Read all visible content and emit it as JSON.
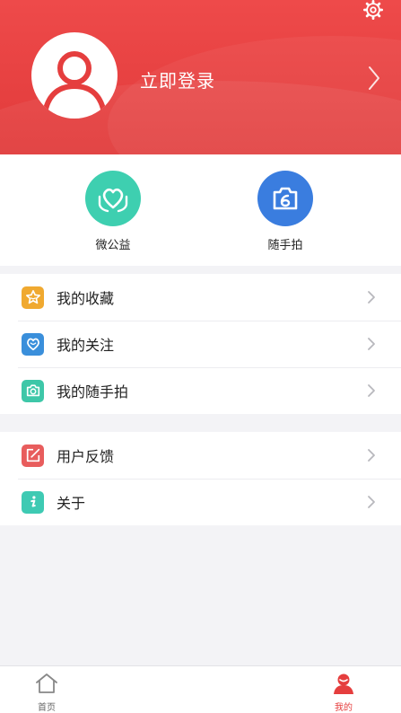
{
  "header": {
    "login_label": "立即登录",
    "bg_color": "#e53e3e"
  },
  "quick_actions": [
    {
      "label": "微公益",
      "icon": "heart-hands-icon",
      "color": "#3ecfb0"
    },
    {
      "label": "随手拍",
      "icon": "camera-icon",
      "color": "#3a7ddf"
    }
  ],
  "menu_group_1": [
    {
      "label": "我的收藏",
      "icon": "star-icon",
      "color": "#f0a930"
    },
    {
      "label": "我的关注",
      "icon": "heart-icon",
      "color": "#3a8fdb"
    },
    {
      "label": "我的随手拍",
      "icon": "camera-icon",
      "color": "#3ec7a8"
    }
  ],
  "menu_group_2": [
    {
      "label": "用户反馈",
      "icon": "edit-icon",
      "color": "#e85d5d"
    },
    {
      "label": "关于",
      "icon": "info-icon",
      "color": "#3ecab3"
    }
  ],
  "tabbar": {
    "home_label": "首页",
    "mine_label": "我的",
    "active_color": "#e53e3e",
    "inactive_color": "#888888"
  }
}
